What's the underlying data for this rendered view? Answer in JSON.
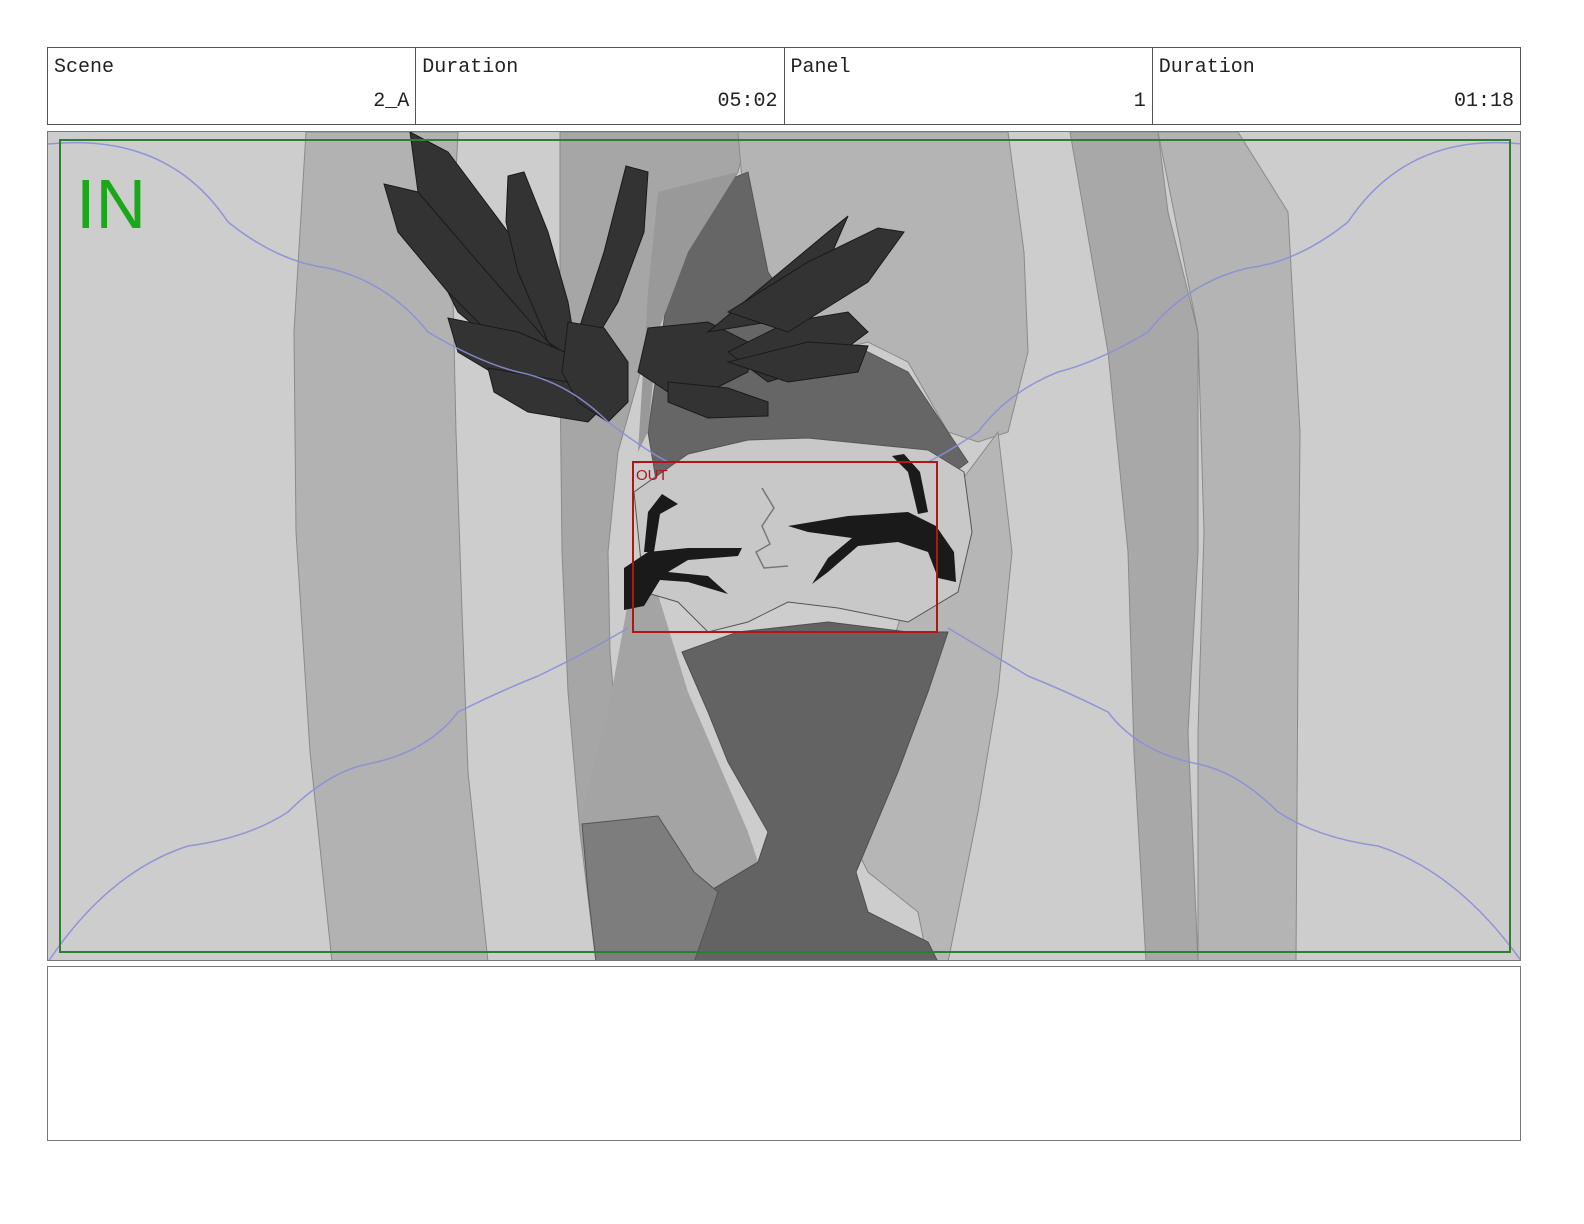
{
  "header": {
    "scene_label": "Scene",
    "scene_value": "2_A",
    "scene_duration_label": "Duration",
    "scene_duration_value": "05:02",
    "panel_label": "Panel",
    "panel_value": "1",
    "panel_duration_label": "Duration",
    "panel_duration_value": "01:18"
  },
  "frame": {
    "in_label": "IN",
    "out_label": "OUT",
    "in_color": "#1aa81a",
    "out_color": "#b0151a",
    "frame_line_color": "#2e7d32",
    "motion_path_color": "#8a8fd6"
  },
  "notes": {
    "text": ""
  }
}
